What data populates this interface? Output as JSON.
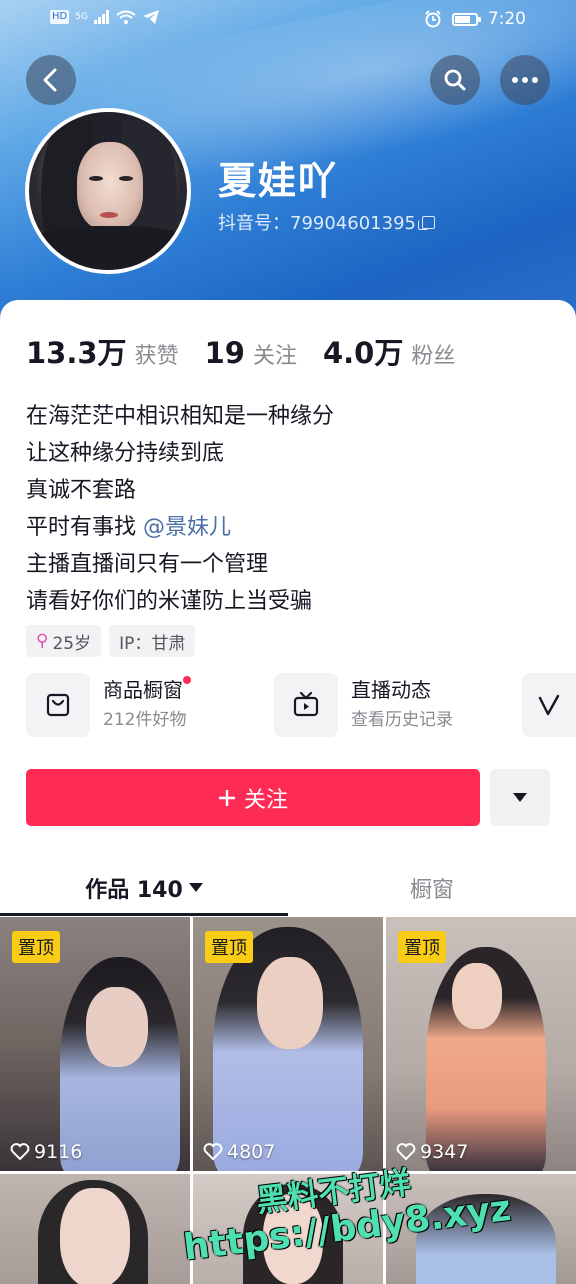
{
  "status_bar": {
    "left_icons": [
      "HD",
      "5G",
      "signal",
      "wifi",
      "telegram-icon"
    ],
    "time": "7:20"
  },
  "profile": {
    "nickname": "夏娃吖",
    "douyin_id": "抖音号：79904601395"
  },
  "stats": [
    {
      "value": "13.3万",
      "label": "获赞"
    },
    {
      "value": "19",
      "label": "关注"
    },
    {
      "value": "4.0万",
      "label": "粉丝"
    }
  ],
  "bio": {
    "lines": [
      "在海茫茫中相识相知是一种缘分",
      "让这种缘分持续到底",
      "真诚不套路"
    ],
    "line4_prefix": "平时有事找",
    "mention": "@景妹儿",
    "line5": "主播直播间只有一个管理",
    "line6": "请看好你们的米谨防上当受骗"
  },
  "tags": {
    "age": "25岁",
    "ip": "IP：甘肃"
  },
  "features": [
    {
      "title": "商品橱窗",
      "subtitle": "212件好物",
      "icon": "shopping-bag-icon"
    },
    {
      "title": "直播动态",
      "subtitle": "查看历史记录",
      "icon": "tv-icon"
    }
  ],
  "follow_button": "关注",
  "tabs": {
    "works": "作品 140",
    "window": "橱窗"
  },
  "posts": [
    {
      "pinned": "置顶",
      "likes": "9116"
    },
    {
      "pinned": "置顶",
      "likes": "4807"
    },
    {
      "pinned": "置顶",
      "likes": "9347"
    }
  ],
  "watermark": {
    "line1": "黑料不打烊",
    "line2": "https://bdy8.xyz"
  },
  "colors": {
    "accent": "#fe2c55",
    "pin_badge": "#facc15",
    "mention": "#4a6fa5"
  }
}
